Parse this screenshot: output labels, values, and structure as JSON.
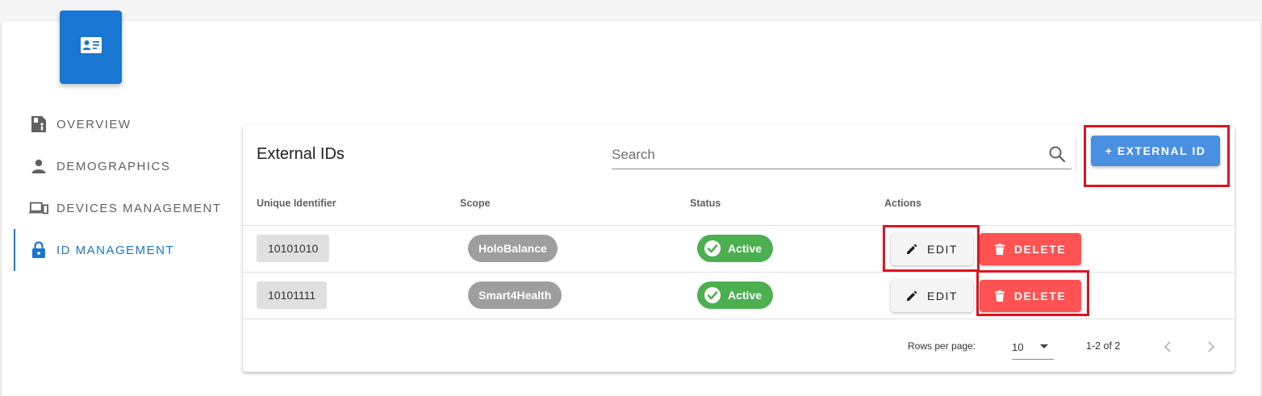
{
  "nav": {
    "items": [
      {
        "label": "OVERVIEW",
        "icon": "id-card-info-icon",
        "active": false
      },
      {
        "label": "DEMOGRAPHICS",
        "icon": "person-icon",
        "active": false
      },
      {
        "label": "DEVICES MANAGEMENT",
        "icon": "devices-icon",
        "active": false
      },
      {
        "label": "ID MANAGEMENT",
        "icon": "lock-icon",
        "active": true
      }
    ]
  },
  "badge": {
    "icon": "contact-card-icon",
    "color": "#1976d2"
  },
  "card": {
    "title": "External IDs",
    "search": {
      "placeholder": "Search",
      "value": ""
    },
    "add_button_label": "+ EXTERNAL ID"
  },
  "table": {
    "headers": [
      "Unique Identifier",
      "Scope",
      "Status",
      "Actions"
    ],
    "rows": [
      {
        "identifier": "10101010",
        "scope": "HoloBalance",
        "status": "Active",
        "edit_label": "EDIT",
        "delete_label": "DELETE"
      },
      {
        "identifier": "10101111",
        "scope": "Smart4Health",
        "status": "Active",
        "edit_label": "EDIT",
        "delete_label": "DELETE"
      }
    ]
  },
  "pagination": {
    "rows_per_page_label": "Rows per page:",
    "rows_per_page_value": "10",
    "range_text": "1-2 of 2"
  },
  "colors": {
    "primary": "#1976d2",
    "add_button": "#4a90e2",
    "status_active": "#4caf50",
    "delete": "#ff5252",
    "scope_chip": "#9e9e9e",
    "highlight": "#e3121f"
  }
}
